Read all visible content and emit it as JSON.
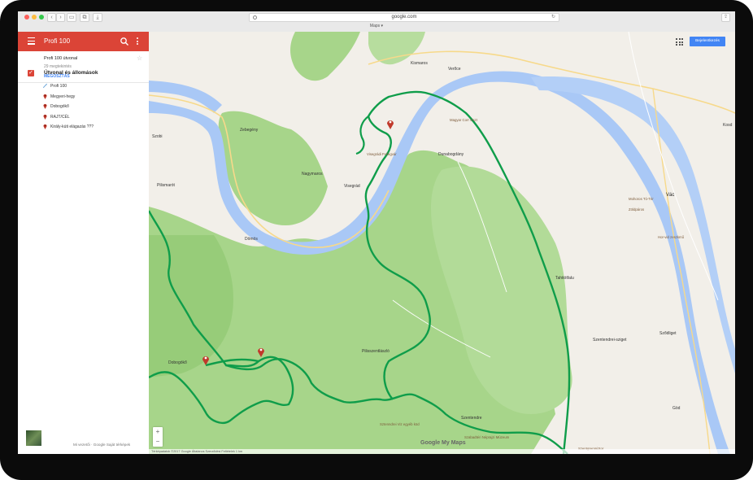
{
  "browser": {
    "url": "google.com",
    "tab_title": "Maps ▾",
    "back": "‹",
    "forward": "›"
  },
  "sidebar": {
    "title": "Profi 100",
    "map_name": "Profi 100 útvonal",
    "map_subtitle": "29 megtekintés",
    "share_label": "MEGOSZTÁS",
    "layer_title": "Útvonal és állomások",
    "items": [
      {
        "label": "Profi 100",
        "icon": "route-icon"
      },
      {
        "label": "Megyeri-hegy",
        "icon": "map-pin-icon"
      },
      {
        "label": "Dobogókő",
        "icon": "map-pin-icon"
      },
      {
        "label": "RAJT/CÉL",
        "icon": "map-pin-icon"
      },
      {
        "label": "Király-kúti elágazás ???",
        "icon": "map-pin-icon"
      }
    ],
    "footer": "Mi vezetői · Google Saját térképek"
  },
  "map": {
    "signin_label": "Bejelentkezés",
    "zoom_in": "+",
    "zoom_out": "−",
    "logo": "Google My Maps",
    "copyright": "Térképadatok ©2017 Google    Általános Szerződési Feltételek    1 km",
    "colors": {
      "water": "#a9c8f6",
      "forest": "#a7d58a",
      "land": "#f1efe8",
      "route": "#0f9d4a",
      "header": "#db4437",
      "road": "#f7d98a"
    },
    "labels": [
      {
        "text": "Kismaros",
        "cls": "town"
      },
      {
        "text": "Verőce",
        "cls": "town"
      },
      {
        "text": "Nagymaros",
        "cls": "town"
      },
      {
        "text": "Visegrád",
        "cls": "town"
      },
      {
        "text": "Dömös",
        "cls": "town"
      },
      {
        "text": "Pilismarót",
        "cls": "town"
      },
      {
        "text": "Zebegény",
        "cls": "town"
      },
      {
        "text": "Vác",
        "cls": "big"
      },
      {
        "text": "Tahitótfalu",
        "cls": "town"
      },
      {
        "text": "Dunabogdány",
        "cls": "town"
      },
      {
        "text": "Szentendre",
        "cls": "town"
      },
      {
        "text": "Sződliget",
        "cls": "town"
      },
      {
        "text": "Göd",
        "cls": "town"
      },
      {
        "text": "Szentendrei-sziget",
        "cls": "town"
      },
      {
        "text": "Kosd",
        "cls": "town"
      },
      {
        "text": "Szobi",
        "cls": "town"
      },
      {
        "text": "Pilisszentlászló",
        "cls": "town"
      },
      {
        "text": "Dobogókő",
        "cls": "town"
      },
      {
        "text": "Magyar Corr Oszt",
        "cls": "poi"
      },
      {
        "text": "Visegrádi Fellegvár",
        "cls": "poi"
      },
      {
        "text": "Mohoros Tó-Tér",
        "cls": "poi"
      },
      {
        "text": "Zöldpáros",
        "cls": "poi"
      },
      {
        "text": "Hor-vid zeszkmű",
        "cls": "poi"
      },
      {
        "text": "Szabadtéri Néprajzi Múzeum",
        "cls": "poi"
      },
      {
        "text": "Sztenndrei Viz egyéb köd",
        "cls": "poi"
      },
      {
        "text": "Szentgrenmiztor",
        "cls": "poi"
      }
    ]
  }
}
